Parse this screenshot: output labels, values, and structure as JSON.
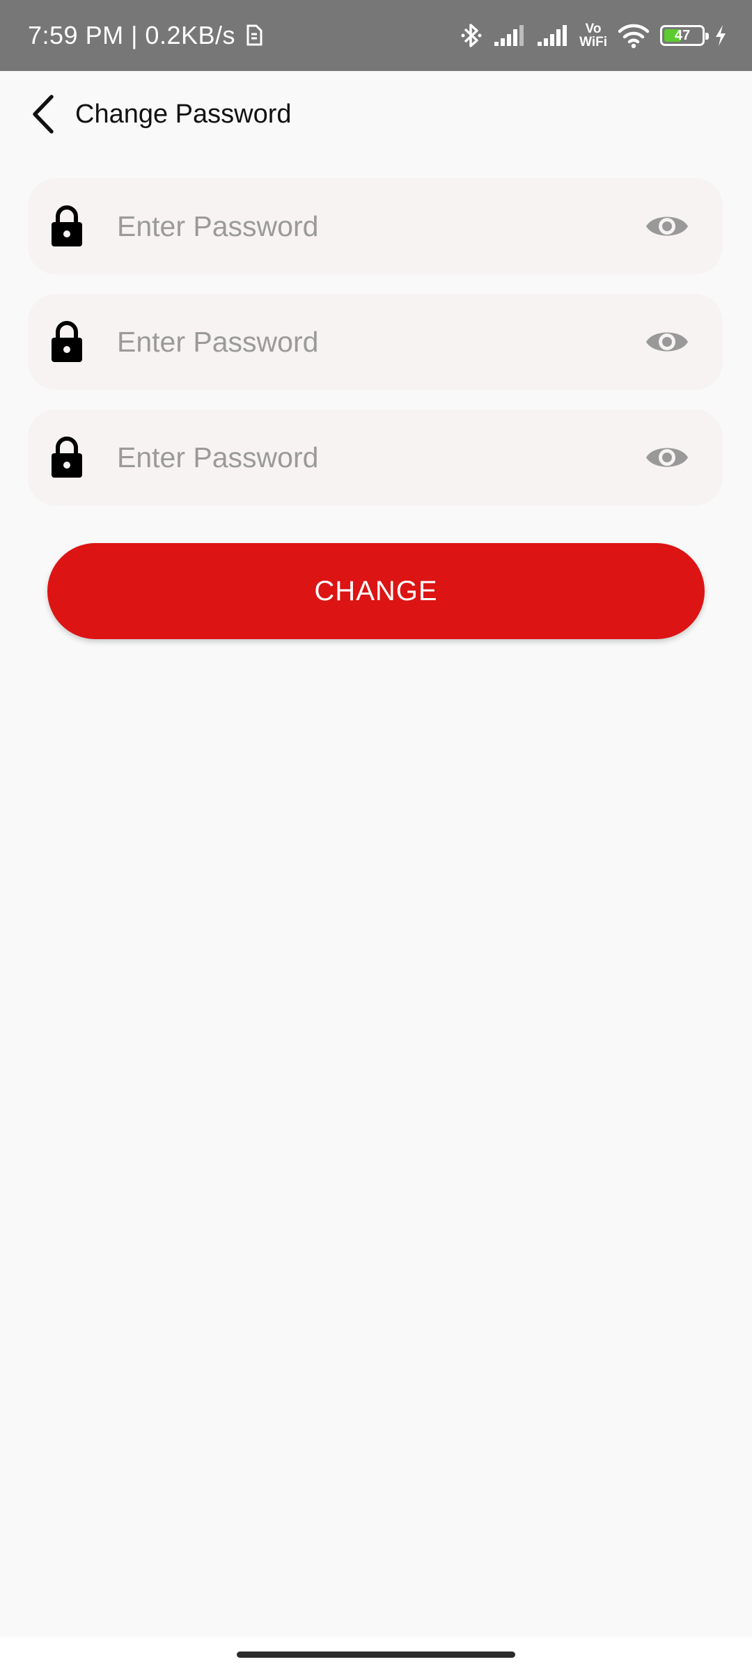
{
  "status_bar": {
    "time_and_speed": "7:59 PM | 0.2KB/s",
    "vowifi_top": "Vo",
    "vowifi_bottom": "WiFi",
    "battery_level": "47",
    "battery_fraction": 0.47,
    "battery_color": "#5ccb2f",
    "icons": [
      "sim-icon",
      "bluetooth-icon",
      "signal-icon",
      "signal-icon",
      "vowifi-icon",
      "wifi-icon",
      "battery-icon",
      "charging-icon"
    ]
  },
  "header": {
    "title": "Change Password",
    "back_icon": "chevron-left-icon"
  },
  "fields": [
    {
      "placeholder": "Enter Password",
      "value": "",
      "lead_icon": "lock-icon",
      "trail_icon": "eye-icon"
    },
    {
      "placeholder": "Enter Password",
      "value": "",
      "lead_icon": "lock-icon",
      "trail_icon": "eye-icon"
    },
    {
      "placeholder": "Enter Password",
      "value": "",
      "lead_icon": "lock-icon",
      "trail_icon": "eye-icon"
    }
  ],
  "actions": {
    "change_label": "CHANGE"
  },
  "colors": {
    "accent": "#dc1414",
    "status_bar": "#777777",
    "field_bg": "#f6f3f2",
    "placeholder": "#9a9a9a"
  }
}
